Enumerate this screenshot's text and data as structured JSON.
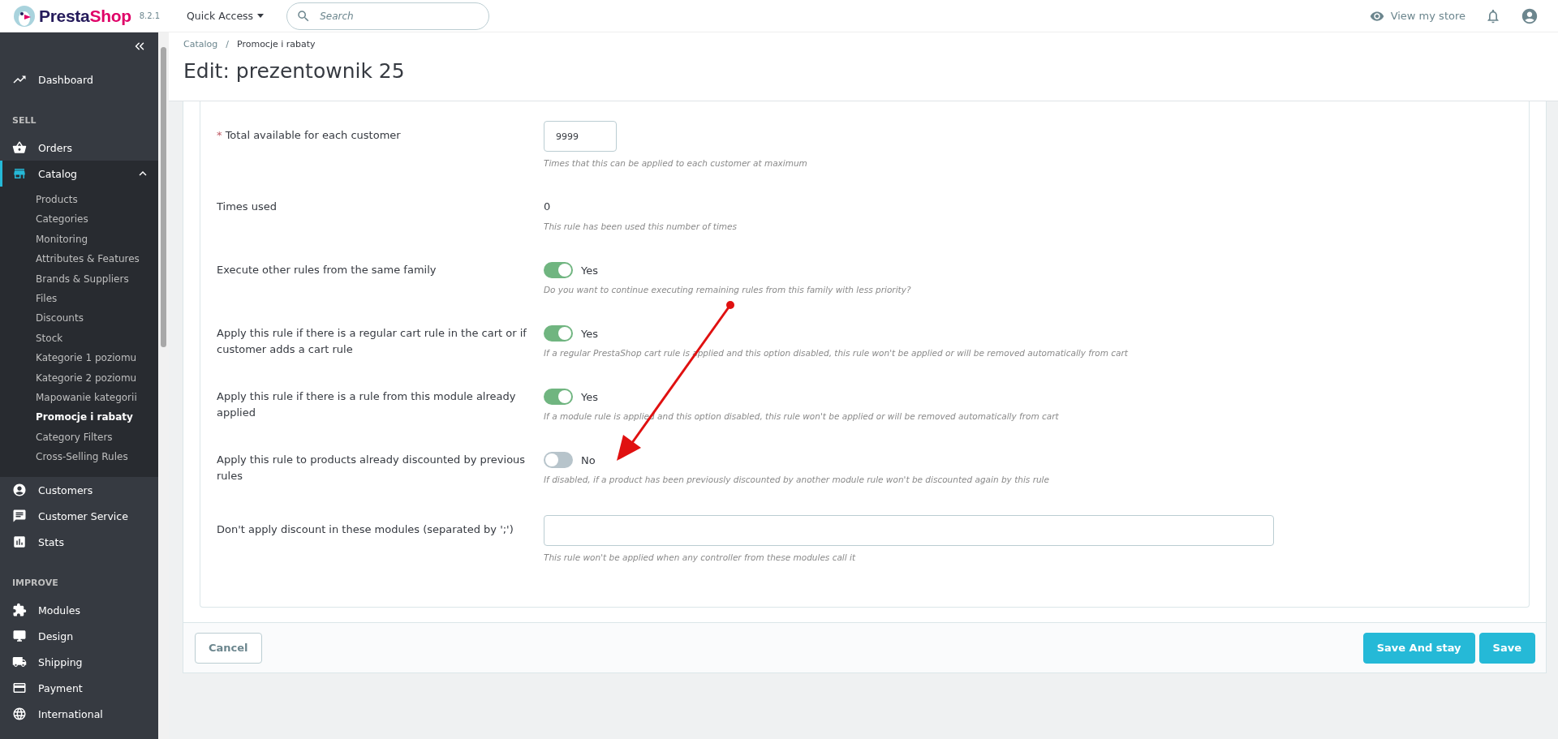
{
  "header": {
    "brand_first": "Presta",
    "brand_second": "Shop",
    "version": "8.2.1",
    "quick_access": "Quick Access",
    "search": {
      "placeholder": "Search"
    },
    "view_store": "View my store"
  },
  "sidebar": {
    "top_items": [
      {
        "label": "Dashboard",
        "selected": false
      }
    ],
    "sections": [
      {
        "heading": "SELL",
        "items": [
          {
            "label": "Orders",
            "selected": false
          },
          {
            "label": "Catalog",
            "selected": true,
            "expanded": true,
            "children": [
              {
                "label": "Products",
                "selected": false
              },
              {
                "label": "Categories",
                "selected": false
              },
              {
                "label": "Monitoring",
                "selected": false
              },
              {
                "label": "Attributes & Features",
                "selected": false
              },
              {
                "label": "Brands & Suppliers",
                "selected": false
              },
              {
                "label": "Files",
                "selected": false
              },
              {
                "label": "Discounts",
                "selected": false
              },
              {
                "label": "Stock",
                "selected": false
              },
              {
                "label": "Kategorie 1 poziomu",
                "selected": false
              },
              {
                "label": "Kategorie 2 poziomu",
                "selected": false
              },
              {
                "label": "Mapowanie kategorii",
                "selected": false
              },
              {
                "label": "Promocje i rabaty",
                "selected": true
              },
              {
                "label": "Category Filters",
                "selected": false
              },
              {
                "label": "Cross-Selling Rules",
                "selected": false
              }
            ]
          },
          {
            "label": "Customers",
            "selected": false
          },
          {
            "label": "Customer Service",
            "selected": false
          },
          {
            "label": "Stats",
            "selected": false
          }
        ]
      },
      {
        "heading": "IMPROVE",
        "items": [
          {
            "label": "Modules",
            "selected": false
          },
          {
            "label": "Design",
            "selected": false
          },
          {
            "label": "Shipping",
            "selected": false
          },
          {
            "label": "Payment",
            "selected": false
          },
          {
            "label": "International",
            "selected": false
          }
        ]
      }
    ]
  },
  "breadcrumb": {
    "items": [
      "Catalog",
      "Promocje i rabaty"
    ],
    "separator": "/"
  },
  "page_title": "Edit: prezentownik 25",
  "form": {
    "rows": [
      {
        "kind": "number_input",
        "label": "Total available for each customer",
        "required_mark": "*",
        "value": "9999",
        "help": "Times that this can be applied to each customer at maximum"
      },
      {
        "kind": "static",
        "label": "Times used",
        "value": "0",
        "help": "This rule has been used this number of times"
      },
      {
        "kind": "toggle",
        "label": "Execute other rules from the same family",
        "on": true,
        "state_label": "Yes",
        "help": "Do you want to continue executing remaining rules from this family with less priority?"
      },
      {
        "kind": "toggle",
        "label": "Apply this rule if there is a regular cart rule in the cart or if customer adds a cart rule",
        "on": true,
        "state_label": "Yes",
        "help": "If a regular PrestaShop cart rule is applied and this option disabled, this rule won't be applied or will be removed automatically from cart"
      },
      {
        "kind": "toggle",
        "label": "Apply this rule if there is a rule from this module already applied",
        "on": true,
        "state_label": "Yes",
        "help": "If a module rule is applied and this option disabled, this rule won't be applied or will be removed automatically from cart"
      },
      {
        "kind": "toggle",
        "label": "Apply this rule to products already discounted by previous rules",
        "on": false,
        "state_label": "No",
        "help": "If disabled, if a product has been previously discounted by another module rule won't be discounted again by this rule"
      },
      {
        "kind": "text_input",
        "label": "Don't apply discount in these modules (separated by ';')",
        "help": "This rule won't be applied when any controller from these modules call it"
      }
    ]
  },
  "footer": {
    "cancel": "Cancel",
    "save_and_stay": "Save And stay",
    "save": "Save"
  }
}
